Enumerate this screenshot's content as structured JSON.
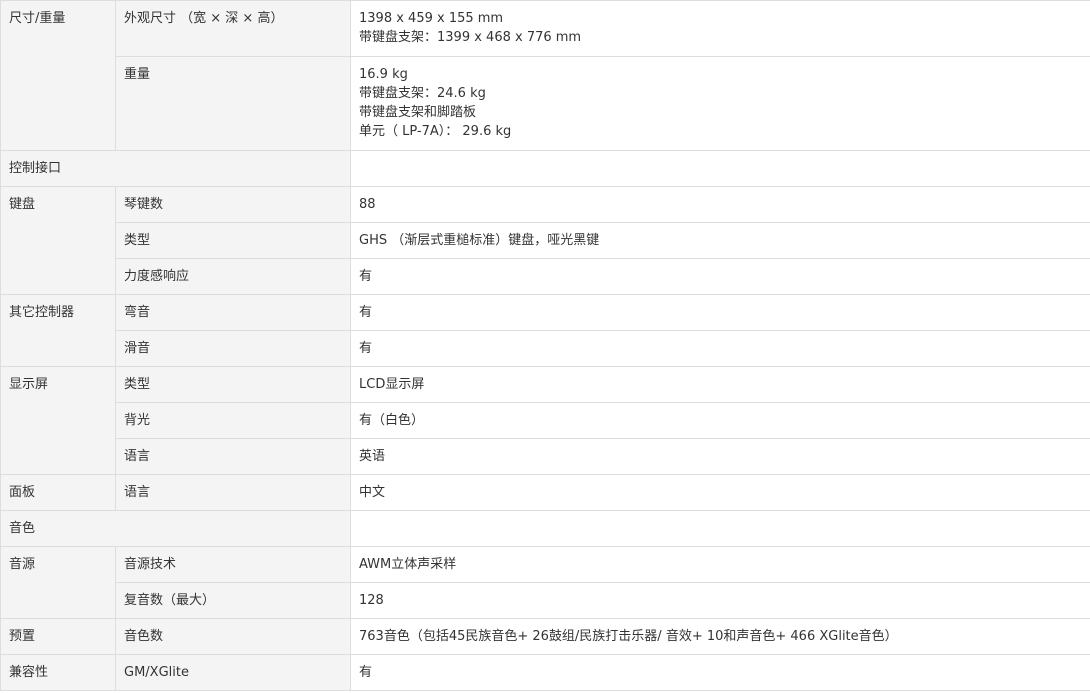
{
  "rows": {
    "dimensions": {
      "category": "尺寸/重量",
      "size_label": "外观尺寸 （宽 × 深 × 高）",
      "size_lines": [
        "1398 x 459 x 155 mm",
        "带键盘支架：1399 x 468 x 776 mm"
      ],
      "weight_label": "重量",
      "weight_lines": [
        "16.9 kg",
        "带键盘支架：24.6 kg",
        "带键盘支架和脚踏板",
        "单元（ LP-7A）： 29.6 kg"
      ]
    },
    "control_interface": {
      "category": "控制接口"
    },
    "keyboard": {
      "category": "键盘",
      "keys_label": "琴键数",
      "keys_value": "88",
      "type_label": "类型",
      "type_value": "GHS （渐层式重槌标准）键盘，哑光黑键",
      "velocity_label": "力度感响应",
      "velocity_value": "有"
    },
    "other_controls": {
      "category": "其它控制器",
      "pitch_label": "弯音",
      "pitch_value": "有",
      "portamento_label": "滑音",
      "portamento_value": "有"
    },
    "display": {
      "category": "显示屏",
      "type_label": "类型",
      "type_value": "LCD显示屏",
      "backlight_label": "背光",
      "backlight_value": "有（白色）",
      "language_label": "语言",
      "language_value": "英语"
    },
    "panel": {
      "category": "面板",
      "language_label": "语言",
      "language_value": "中文"
    },
    "voices": {
      "category": "音色"
    },
    "tone_source": {
      "category": "音源",
      "tech_label": "音源技术",
      "tech_value": "AWM立体声采样",
      "poly_label": "复音数（最大）",
      "poly_value": "128"
    },
    "presets": {
      "category": "预置",
      "count_label": "音色数",
      "count_value": "763音色（包括45民族音色+ 26鼓组/民族打击乐器/ 音效+ 10和声音色+ 466 XGlite音色）"
    },
    "compatibility": {
      "category": "兼容性",
      "std_label": "GM/XGlite",
      "std_value": "有"
    }
  }
}
